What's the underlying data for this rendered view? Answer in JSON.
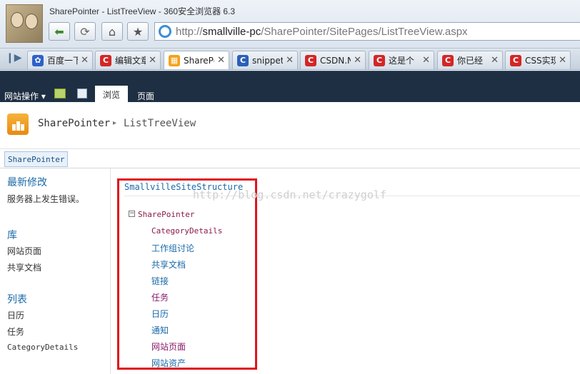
{
  "browser": {
    "window_title": "SharePointer - ListTreeView - 360安全浏览器 6.3",
    "url_prefix": "http://",
    "url_host": "smallville-pc",
    "url_path": "/SharePointer/SitePages/ListTreeView.aspx"
  },
  "tabs": [
    {
      "label": "百度一下",
      "icon": "paw-icon"
    },
    {
      "label": "编辑文章",
      "icon": "csdn-c-icon"
    },
    {
      "label": "SharePc",
      "icon": "sharepoint-icon"
    },
    {
      "label": "snippet",
      "icon": "c-icon"
    },
    {
      "label": "CSDN.N",
      "icon": "csdn-c-icon"
    },
    {
      "label": "这是个",
      "icon": "csdn-c-icon"
    },
    {
      "label": "你已经",
      "icon": "csdn-c-icon"
    },
    {
      "label": "CSS实现",
      "icon": "csdn-c-icon"
    }
  ],
  "ribbon": {
    "site_actions": "网站操作 ▾",
    "browse_tab": "浏览",
    "page_tab": "页面"
  },
  "site": {
    "title": "SharePointer",
    "separator": "▸",
    "page": "ListTreeView",
    "breadcrumb": "SharePointer"
  },
  "quick_launch": {
    "recent_heading": "最新修改",
    "recent_error": "服务器上发生错误。",
    "libraries_heading": "库",
    "libraries": [
      "网站页面",
      "共享文档"
    ],
    "lists_heading": "列表",
    "lists": [
      "日历",
      "任务",
      "CategoryDetails"
    ]
  },
  "tree": {
    "root": "SmallvilleSiteStructure",
    "watermark": "http://blog.csdn.net/crazygolf",
    "node": "SharePointer",
    "expander": "−",
    "children": [
      {
        "label": "CategoryDetails",
        "style": "mono"
      },
      {
        "label": "工作组讨论",
        "style": "link"
      },
      {
        "label": "共享文档",
        "style": "link"
      },
      {
        "label": "链接",
        "style": "link"
      },
      {
        "label": "任务",
        "style": "visited"
      },
      {
        "label": "日历",
        "style": "link"
      },
      {
        "label": "通知",
        "style": "link"
      },
      {
        "label": "网站页面",
        "style": "visited"
      },
      {
        "label": "网站资产",
        "style": "link"
      }
    ]
  },
  "colors": {
    "ribbon_bg": "#1f2f43",
    "link": "#1a6aa8",
    "visited": "#8a1a6a",
    "highlight_box": "#e0141c"
  }
}
